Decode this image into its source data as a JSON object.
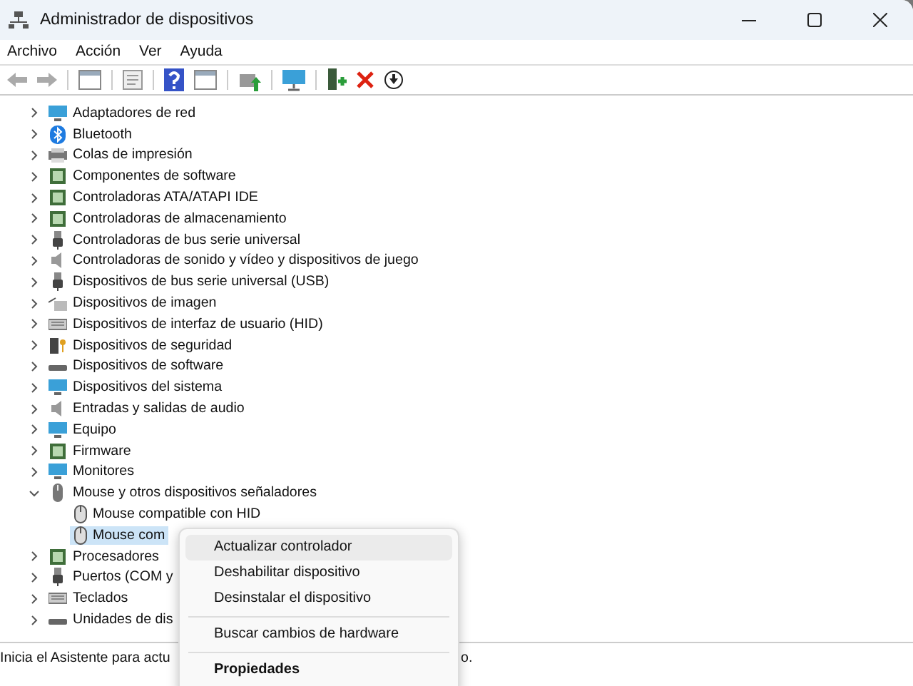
{
  "window": {
    "title": "Administrador de dispositivos"
  },
  "menu_bar": [
    "Archivo",
    "Acción",
    "Ver",
    "Ayuda"
  ],
  "tree": [
    {
      "label": "Adaptadores de red",
      "expanded": false
    },
    {
      "label": "Bluetooth",
      "expanded": false
    },
    {
      "label": "Colas de impresión",
      "expanded": false
    },
    {
      "label": "Componentes de software",
      "expanded": false
    },
    {
      "label": "Controladoras ATA/ATAPI IDE",
      "expanded": false
    },
    {
      "label": "Controladoras de almacenamiento",
      "expanded": false
    },
    {
      "label": "Controladoras de bus serie universal",
      "expanded": false
    },
    {
      "label": "Controladoras de sonido y vídeo y dispositivos de juego",
      "expanded": false
    },
    {
      "label": "Dispositivos de bus serie universal (USB)",
      "expanded": false
    },
    {
      "label": "Dispositivos de imagen",
      "expanded": false
    },
    {
      "label": "Dispositivos de interfaz de usuario (HID)",
      "expanded": false
    },
    {
      "label": "Dispositivos de seguridad",
      "expanded": false
    },
    {
      "label": "Dispositivos de software",
      "expanded": false
    },
    {
      "label": "Dispositivos del sistema",
      "expanded": false
    },
    {
      "label": "Entradas y salidas de audio",
      "expanded": false
    },
    {
      "label": "Equipo",
      "expanded": false
    },
    {
      "label": "Firmware",
      "expanded": false
    },
    {
      "label": "Monitores",
      "expanded": false
    },
    {
      "label": "Mouse y otros dispositivos señaladores",
      "expanded": true,
      "children": [
        {
          "label": "Mouse compatible con HID",
          "selected": false
        },
        {
          "label": "Mouse com",
          "selected": true
        }
      ]
    },
    {
      "label": "Procesadores",
      "expanded": false
    },
    {
      "label": "Puertos (COM y",
      "expanded": false
    },
    {
      "label": "Teclados",
      "expanded": false
    },
    {
      "label": "Unidades de dis",
      "expanded": false
    }
  ],
  "status_bar": {
    "text": "Inicia el Asistente para actu",
    "tail": "o."
  },
  "context_menu": [
    {
      "kind": "item",
      "label": "Actualizar controlador",
      "selected": true
    },
    {
      "kind": "item",
      "label": "Deshabilitar dispositivo",
      "selected": false
    },
    {
      "kind": "item",
      "label": "Desinstalar el dispositivo",
      "selected": false
    },
    {
      "kind": "separator"
    },
    {
      "kind": "item",
      "label": "Buscar cambios de hardware",
      "selected": false
    },
    {
      "kind": "separator"
    },
    {
      "kind": "default",
      "label": "Propiedades",
      "selected": false
    }
  ]
}
